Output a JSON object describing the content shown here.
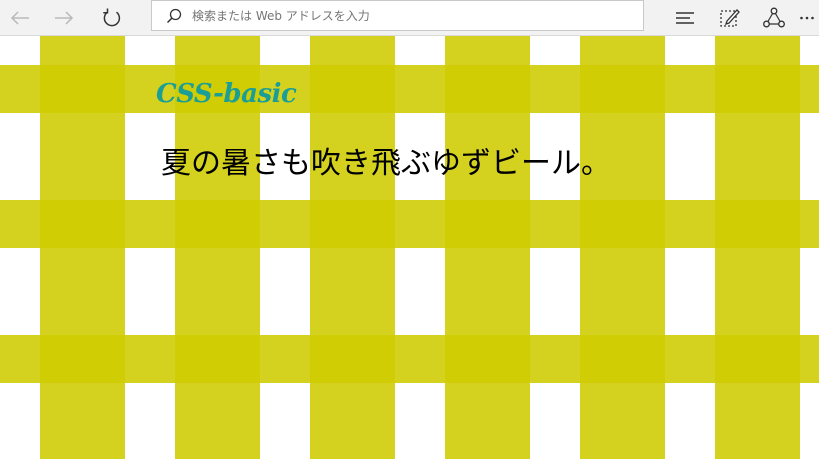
{
  "toolbar": {
    "address_placeholder": "検索または Web アドレスを入力",
    "address_value": ""
  },
  "icons": {
    "back": "back-arrow-icon",
    "forward": "forward-arrow-icon",
    "refresh": "refresh-icon",
    "search": "search-icon",
    "hub": "hub-icon",
    "web_note": "web-note-icon",
    "share": "share-icon",
    "more": "more-icon"
  },
  "page": {
    "logo": "CSS-basic",
    "heading": "夏の暑さも吹き飛ぶゆずビール。"
  },
  "colors": {
    "logo": "#1a9e96",
    "gingham": "#cfcc00",
    "toolbar_bg": "#f2f2f2"
  }
}
